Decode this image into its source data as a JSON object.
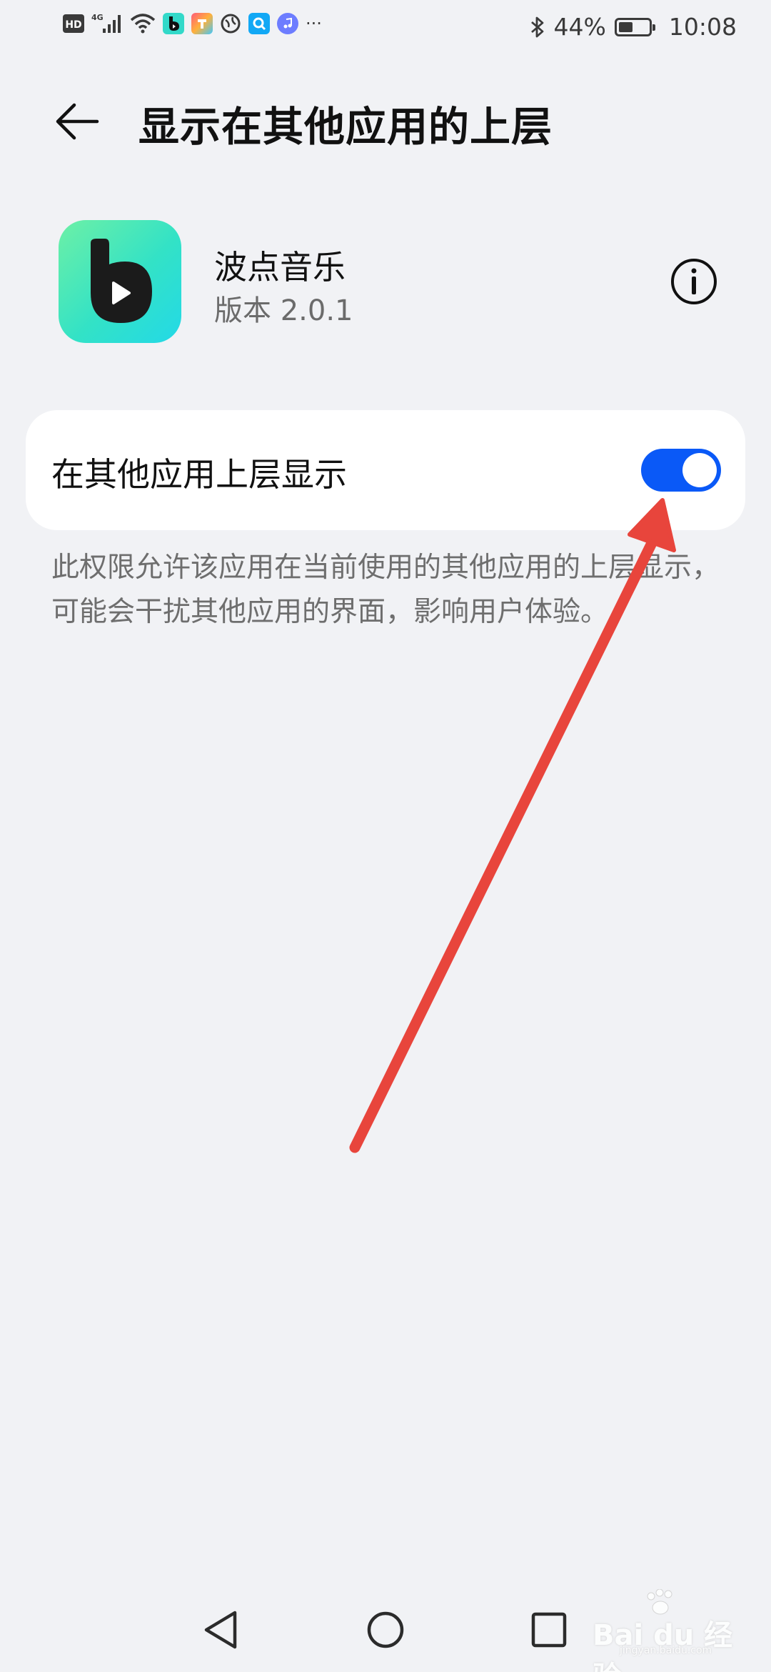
{
  "status_bar": {
    "left_labels": {
      "hd": "HD",
      "network": "4G",
      "more": "···"
    },
    "battery_percent": "44%",
    "time": "10:08"
  },
  "header": {
    "title": "显示在其他应用的上层"
  },
  "app": {
    "name": "波点音乐",
    "version": "版本 2.0.1"
  },
  "setting": {
    "label": "在其他应用上层显示",
    "enabled": true
  },
  "description": "此权限允许该应用在当前使用的其他应用的上层显示，可能会干扰其他应用的界面，影响用户体验。",
  "colors": {
    "background": "#f1f2f5",
    "toggle_on": "#0a59f7",
    "annotation_arrow": "#e8453c",
    "app_icon_gradient_start": "#6df0a6",
    "app_icon_gradient_end": "#23d9e7"
  },
  "watermark": {
    "brand": "Bai du 经验",
    "url": "jingyan.baidu.com"
  }
}
